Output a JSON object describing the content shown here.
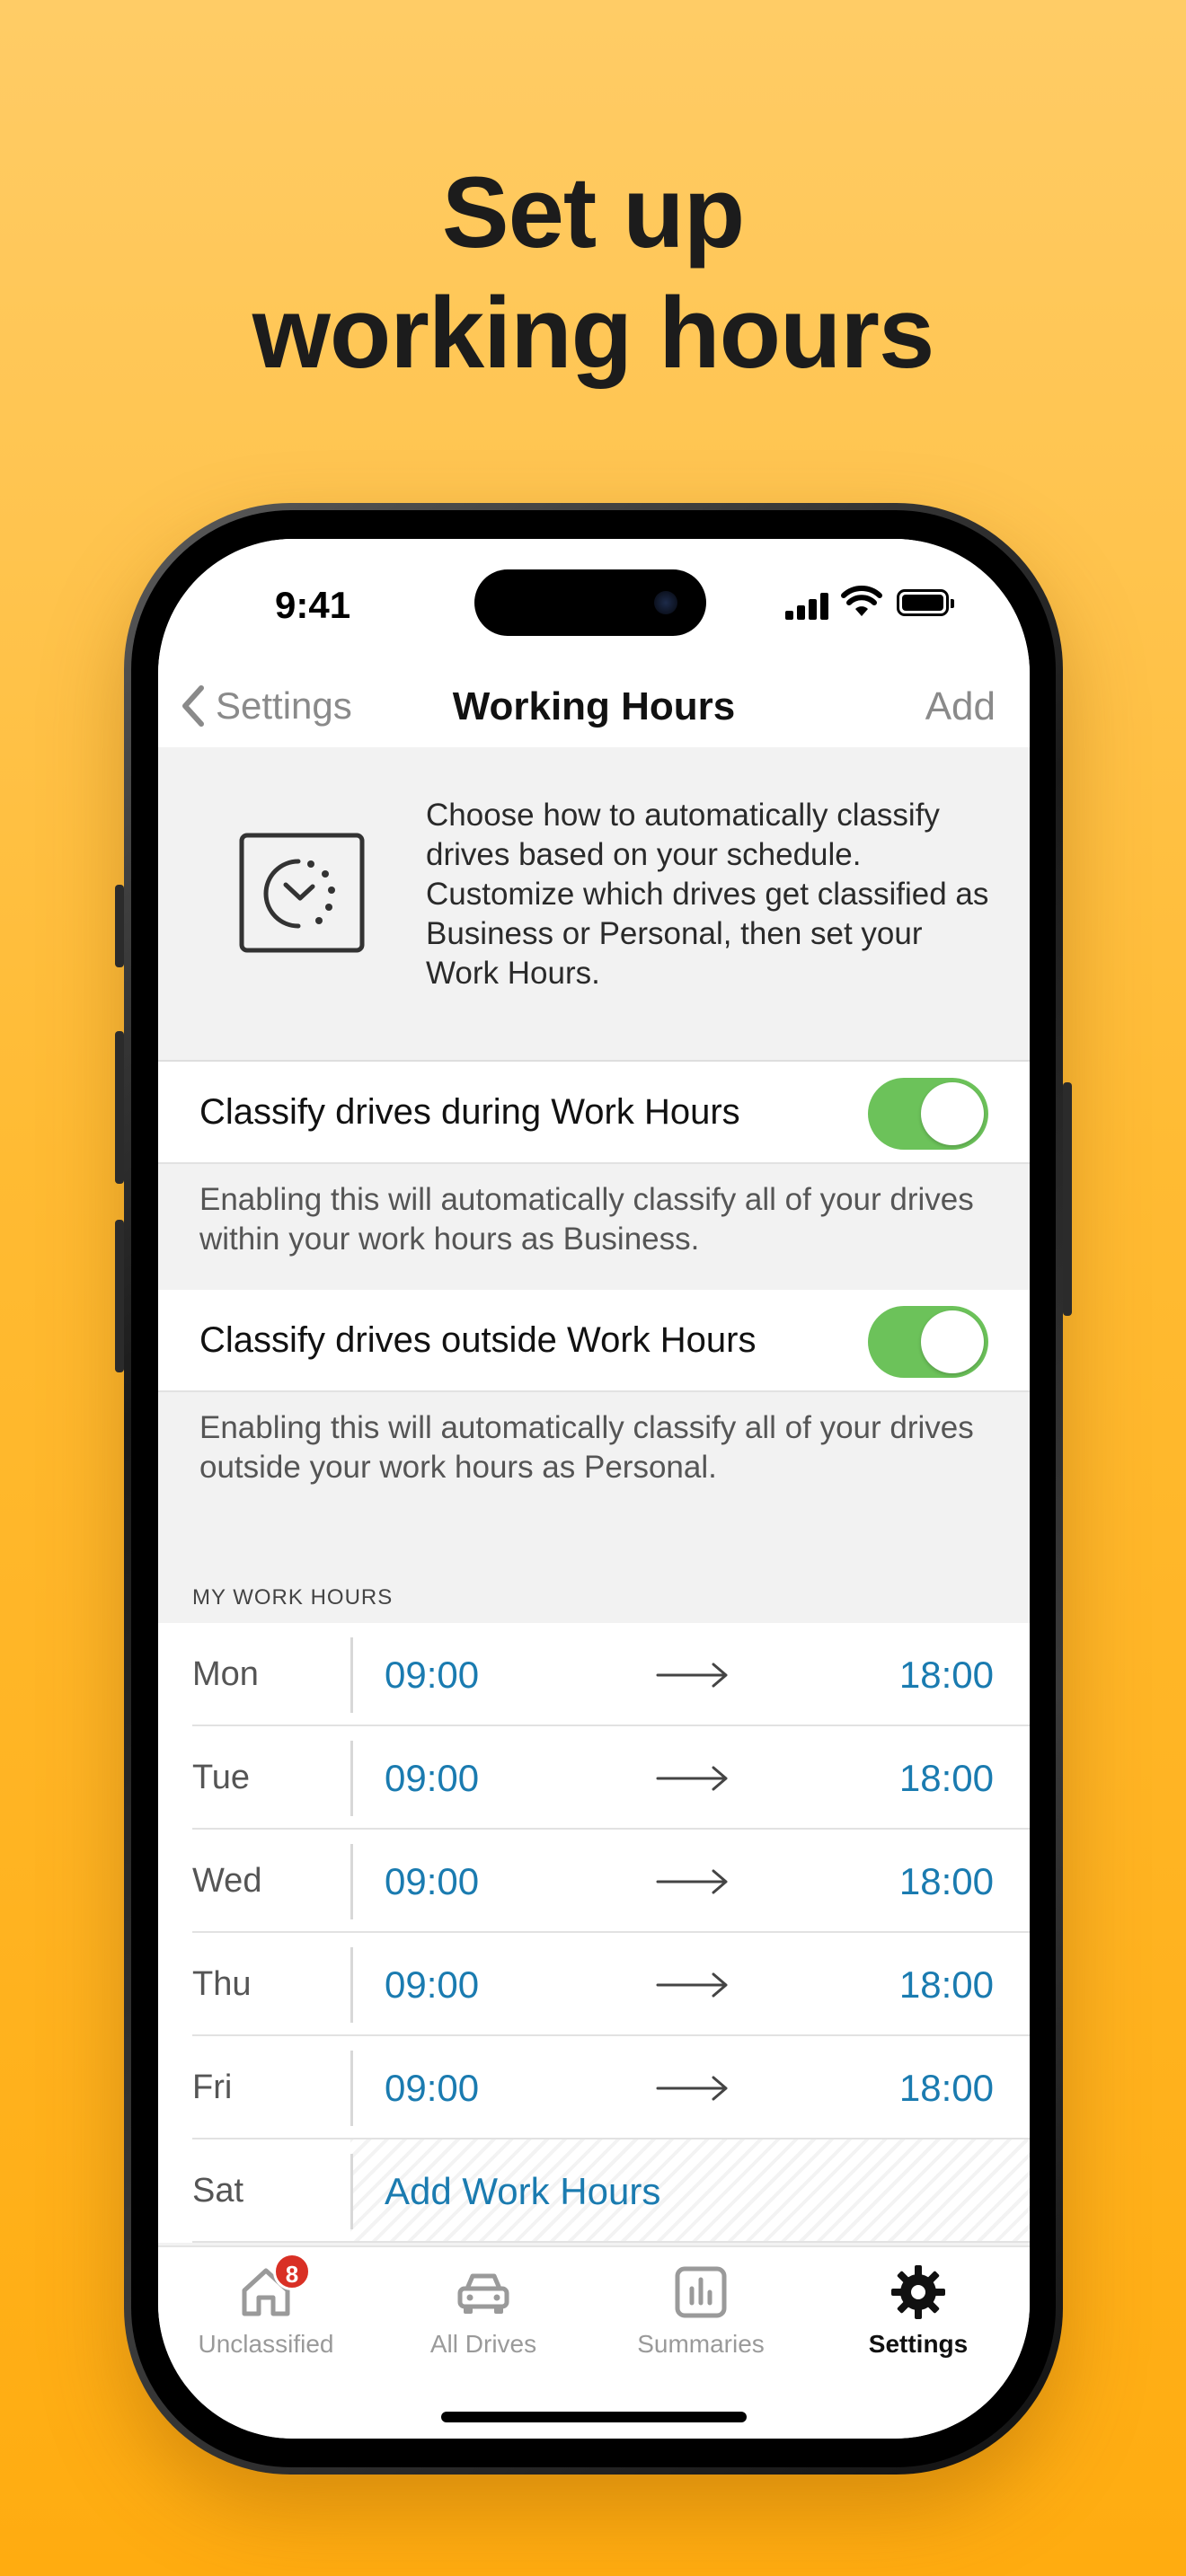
{
  "headline": {
    "line1": "Set up",
    "line2": "working hours"
  },
  "status_bar": {
    "time": "9:41"
  },
  "nav": {
    "back_label": "Settings",
    "title": "Working Hours",
    "action_label": "Add"
  },
  "intro": {
    "icon": "clock-schedule-icon",
    "text": "Choose how to automatically classify drives based on your schedule. Customize which drives get classified as Business or Personal, then set your Work Hours."
  },
  "toggles": [
    {
      "label": "Classify drives during Work Hours",
      "enabled": true,
      "note": "Enabling this will automatically classify all of your drives within your work hours as Business."
    },
    {
      "label": "Classify drives outside Work Hours",
      "enabled": true,
      "note": "Enabling this will automatically classify all of your drives outside your work hours as Personal."
    }
  ],
  "work_hours": {
    "header": "MY WORK HOURS",
    "days": [
      {
        "day": "Mon",
        "start": "09:00",
        "end": "18:00"
      },
      {
        "day": "Tue",
        "start": "09:00",
        "end": "18:00"
      },
      {
        "day": "Wed",
        "start": "09:00",
        "end": "18:00"
      },
      {
        "day": "Thu",
        "start": "09:00",
        "end": "18:00"
      },
      {
        "day": "Fri",
        "start": "09:00",
        "end": "18:00"
      },
      {
        "day": "Sat",
        "add_label": "Add Work Hours"
      }
    ]
  },
  "tabbar": {
    "tabs": [
      {
        "label": "Unclassified",
        "icon": "home-icon",
        "badge": "8",
        "active": false
      },
      {
        "label": "All Drives",
        "icon": "car-icon",
        "active": false
      },
      {
        "label": "Summaries",
        "icon": "bar-chart-icon",
        "active": false
      },
      {
        "label": "Settings",
        "icon": "gear-icon",
        "active": true
      }
    ]
  },
  "colors": {
    "background": "#FFBB33",
    "toggle_on": "#6CC25A",
    "link": "#1A7BB0",
    "badge": "#D93025"
  }
}
